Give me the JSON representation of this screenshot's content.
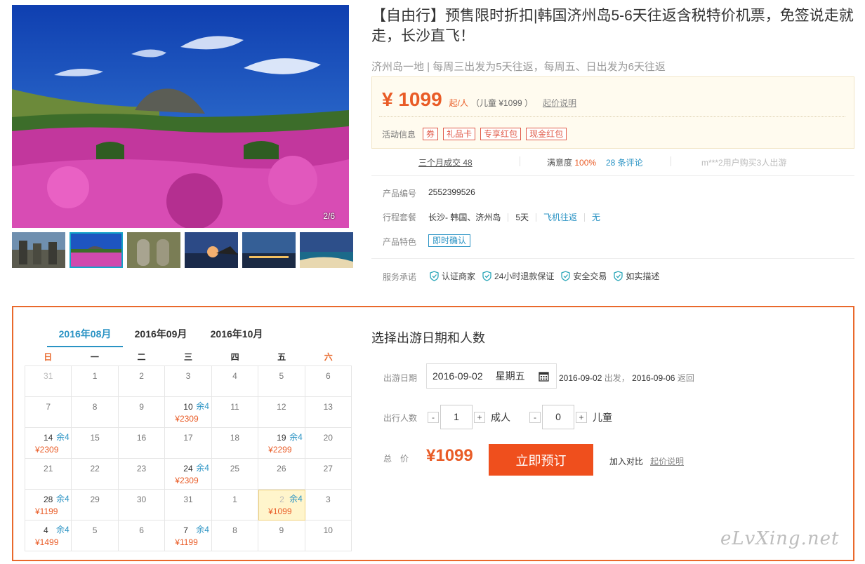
{
  "gallery": {
    "counter": "2/6",
    "thumbnails": [
      {
        "name": "stone-statues"
      },
      {
        "name": "mountain-flowers"
      },
      {
        "name": "dolhareubang"
      },
      {
        "name": "coastal-sunset"
      },
      {
        "name": "city-night"
      },
      {
        "name": "beach-night"
      }
    ]
  },
  "product": {
    "title": "【自由行】预售限时折扣|韩国济州岛5-6天往返含税特价机票，免签说走就走，长沙直飞！",
    "subtitle": "济州岛一地 | 每周三出发为5天往返，每周五、日出发为6天往返",
    "price": "¥ 1099",
    "price_unit": "起/人",
    "child_price": "（儿童 ¥1099 ）",
    "price_explain": "起价说明",
    "promo_label": "活动信息",
    "promo_tags": [
      "券",
      "礼品卡",
      "专享红包",
      "现金红包"
    ],
    "stats": {
      "deals": "三个月成交 48",
      "satisfaction_label": "满意度",
      "satisfaction_value": "100%",
      "reviews": "28 条评论",
      "recent": "m***2用户购买3人出游"
    },
    "info": {
      "code_label": "产品编号",
      "code_value": "2552399526",
      "package_label": "行程套餐",
      "package_route": "长沙- 韩国、济州岛",
      "package_days": "5天",
      "package_flight": "飞机往返",
      "package_extra": "无",
      "feature_label": "产品特色",
      "feature_tag": "即时确认",
      "service_label": "服务承诺",
      "services": [
        "认证商家",
        "24小时退款保证",
        "安全交易",
        "如实描述"
      ]
    }
  },
  "calendar": {
    "tabs": [
      "2016年08月",
      "2016年09月",
      "2016年10月"
    ],
    "active_tab": 0,
    "weekdays": [
      "日",
      "一",
      "二",
      "三",
      "四",
      "五",
      "六"
    ],
    "cells": [
      {
        "d": "31",
        "dim": true
      },
      {
        "d": "1"
      },
      {
        "d": "2"
      },
      {
        "d": "3"
      },
      {
        "d": "4"
      },
      {
        "d": "5"
      },
      {
        "d": "6"
      },
      {
        "d": "7"
      },
      {
        "d": "8"
      },
      {
        "d": "9"
      },
      {
        "d": "10",
        "rem": "余4",
        "price": "¥2309"
      },
      {
        "d": "11"
      },
      {
        "d": "12"
      },
      {
        "d": "13"
      },
      {
        "d": "14",
        "rem": "余4",
        "price": "¥2309"
      },
      {
        "d": "15"
      },
      {
        "d": "16"
      },
      {
        "d": "17"
      },
      {
        "d": "18"
      },
      {
        "d": "19",
        "rem": "余4",
        "price": "¥2299"
      },
      {
        "d": "20"
      },
      {
        "d": "21"
      },
      {
        "d": "22"
      },
      {
        "d": "23"
      },
      {
        "d": "24",
        "rem": "余4",
        "price": "¥2309"
      },
      {
        "d": "25"
      },
      {
        "d": "26"
      },
      {
        "d": "27"
      },
      {
        "d": "28",
        "rem": "余4",
        "price": "¥1199"
      },
      {
        "d": "29"
      },
      {
        "d": "30"
      },
      {
        "d": "31"
      },
      {
        "d": "1"
      },
      {
        "d": "2",
        "rem": "余4",
        "price": "¥1099",
        "selected": true
      },
      {
        "d": "3"
      },
      {
        "d": "4",
        "rem": "余4",
        "price": "¥1499"
      },
      {
        "d": "5"
      },
      {
        "d": "6"
      },
      {
        "d": "7",
        "rem": "余4",
        "price": "¥1199"
      },
      {
        "d": "8"
      },
      {
        "d": "9"
      },
      {
        "d": "10"
      }
    ]
  },
  "booking": {
    "title": "选择出游日期和人数",
    "date_label": "出游日期",
    "date_value": "2016-09-02",
    "date_weekday": "星期五",
    "depart_date": "2016-09-02",
    "depart_text": "出发，",
    "return_date": "2016-09-06",
    "return_text": "返回",
    "people_label": "出行人数",
    "adult_count": "1",
    "adult_unit": "成人",
    "child_count": "0",
    "child_unit": "儿童",
    "minus": "-",
    "plus": "+",
    "total_label": "总　价",
    "total_price": "¥1099",
    "book_button": "立即预订",
    "compare": "加入对比",
    "compare_explain": "起价说明"
  },
  "watermark": "eLvXing.net",
  "colors": {
    "accent": "#e95c27",
    "link": "#2a93c4",
    "button": "#ef4f1d",
    "panel_border": "#e9692c"
  }
}
